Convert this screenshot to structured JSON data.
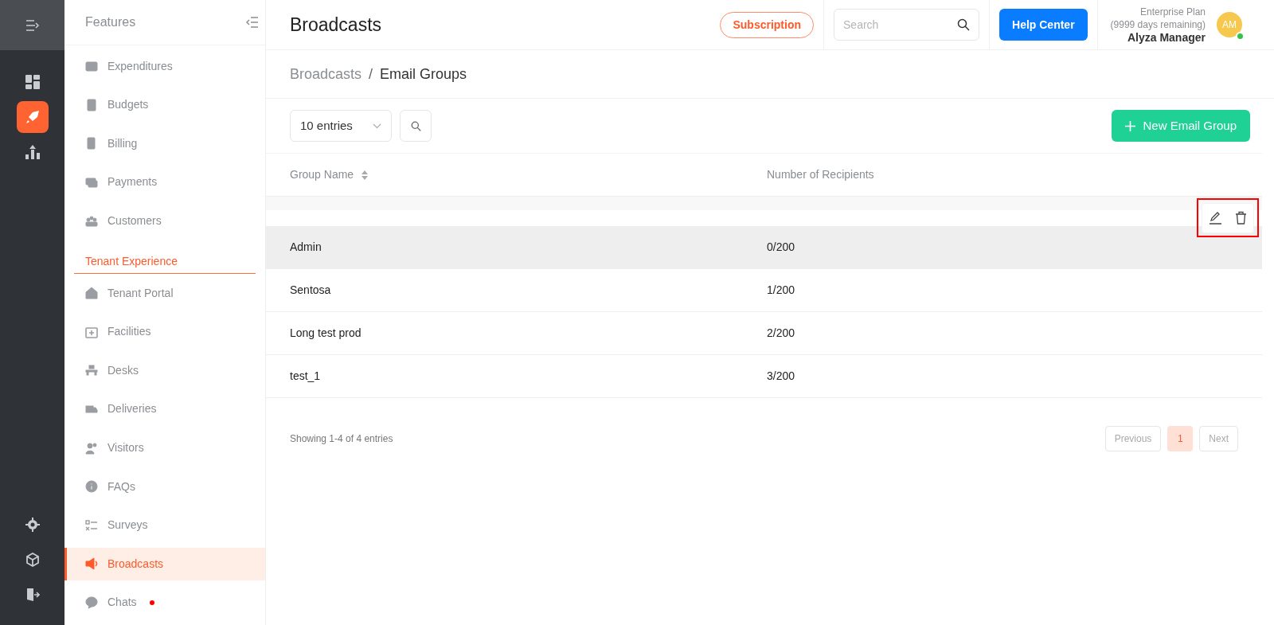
{
  "rail": {
    "top": [
      {
        "selected": false
      },
      {
        "selected": true
      },
      {
        "selected": false
      }
    ],
    "bottom": [
      {
        "selected": false
      },
      {
        "selected": false
      },
      {
        "selected": false
      }
    ]
  },
  "sidebar": {
    "title": "Features",
    "items": [
      {
        "kind": "item",
        "label": "Expenditures",
        "selected": false,
        "unread": false
      },
      {
        "kind": "item",
        "label": "Budgets",
        "selected": false,
        "unread": false
      },
      {
        "kind": "item",
        "label": "Billing",
        "selected": false,
        "unread": false
      },
      {
        "kind": "item",
        "label": "Payments",
        "selected": false,
        "unread": false
      },
      {
        "kind": "item",
        "label": "Customers",
        "selected": false,
        "unread": false
      },
      {
        "kind": "section",
        "label": "Tenant Experience"
      },
      {
        "kind": "item",
        "label": "Tenant Portal",
        "selected": false,
        "unread": false
      },
      {
        "kind": "item",
        "label": "Facilities",
        "selected": false,
        "unread": false
      },
      {
        "kind": "item",
        "label": "Desks",
        "selected": false,
        "unread": false
      },
      {
        "kind": "item",
        "label": "Deliveries",
        "selected": false,
        "unread": false
      },
      {
        "kind": "item",
        "label": "Visitors",
        "selected": false,
        "unread": false
      },
      {
        "kind": "item",
        "label": "FAQs",
        "selected": false,
        "unread": false
      },
      {
        "kind": "item",
        "label": "Surveys",
        "selected": false,
        "unread": false
      },
      {
        "kind": "item",
        "label": "Broadcasts",
        "selected": true,
        "unread": false
      },
      {
        "kind": "item",
        "label": "Chats",
        "selected": false,
        "unread": true
      }
    ]
  },
  "header": {
    "title": "Broadcasts",
    "subscription": "Subscription",
    "search": {
      "placeholder": "Search"
    },
    "help": "Help Center",
    "plan": "Enterprise Plan",
    "remaining": "(9999 days remaining)",
    "user": "Alyza Manager",
    "initials": "AM",
    "online": true
  },
  "breadcrumb": {
    "separator": "/",
    "items": [
      {
        "label": "Broadcasts",
        "current": false
      },
      {
        "label": "Email Groups",
        "current": true
      }
    ]
  },
  "toolbar": {
    "entries": "10 entries",
    "new_button": "New Email Group"
  },
  "table": {
    "columns": [
      {
        "label": "Group Name",
        "sortable": true
      },
      {
        "label": "Number of Recipients",
        "sortable": false
      }
    ],
    "rows": [
      {
        "name": "Admin",
        "recipients": "0/200",
        "hovered": true
      },
      {
        "name": "Sentosa",
        "recipients": "1/200",
        "hovered": false
      },
      {
        "name": "Long test prod",
        "recipients": "2/200",
        "hovered": false
      },
      {
        "name": "test_1",
        "recipients": "3/200",
        "hovered": false
      }
    ]
  },
  "footer": {
    "summary": "Showing 1-4 of 4 entries",
    "pages": [
      {
        "label": "Previous",
        "kind": "nav",
        "selected": false
      },
      {
        "label": "1",
        "kind": "page",
        "selected": true
      },
      {
        "label": "Next",
        "kind": "nav",
        "selected": false
      }
    ]
  }
}
